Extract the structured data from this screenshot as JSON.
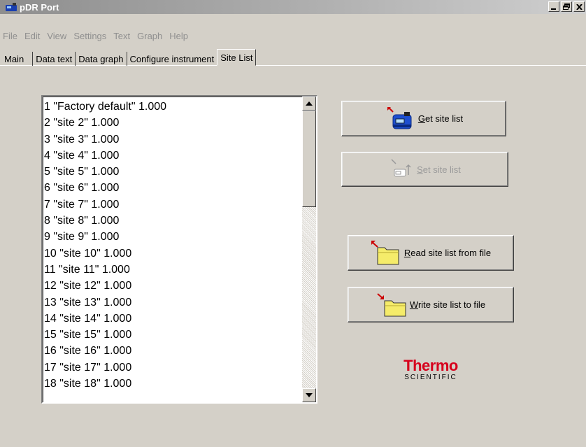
{
  "window": {
    "title": "pDR Port"
  },
  "menu": [
    "File",
    "Edit",
    "View",
    "Settings",
    "Text",
    "Graph",
    "Help"
  ],
  "tabs": [
    "Main",
    "Data text",
    "Data graph",
    "Configure instrument",
    "Site List"
  ],
  "active_tab": "Site List",
  "site_list": [
    "1 \"Factory default\" 1.000",
    "2 \"site 2\" 1.000",
    "3 \"site 3\" 1.000",
    "4 \"site 4\" 1.000",
    "5 \"site 5\" 1.000",
    "6 \"site 6\" 1.000",
    "7 \"site 7\" 1.000",
    "8 \"site 8\" 1.000",
    "9 \"site 9\" 1.000",
    "10 \"site 10\" 1.000",
    "11 \"site 11\" 1.000",
    "12 \"site 12\" 1.000",
    "13 \"site 13\" 1.000",
    "14 \"site 14\" 1.000",
    "15 \"site 15\" 1.000",
    "16 \"site 16\" 1.000",
    "17 \"site 17\" 1.000",
    "18 \"site 18\" 1.000"
  ],
  "buttons": {
    "get_site_list": {
      "label_key": "G",
      "label_rest": "et site list"
    },
    "set_site_list": {
      "label_key": "S",
      "label_rest": "et site list"
    },
    "read_file": {
      "label_key": "R",
      "label_rest": "ead site list from file"
    },
    "write_file": {
      "label_key": "W",
      "label_rest": "rite site list to file"
    }
  },
  "logo": {
    "main": "Thermo",
    "sub": "SCIENTIFIC"
  }
}
